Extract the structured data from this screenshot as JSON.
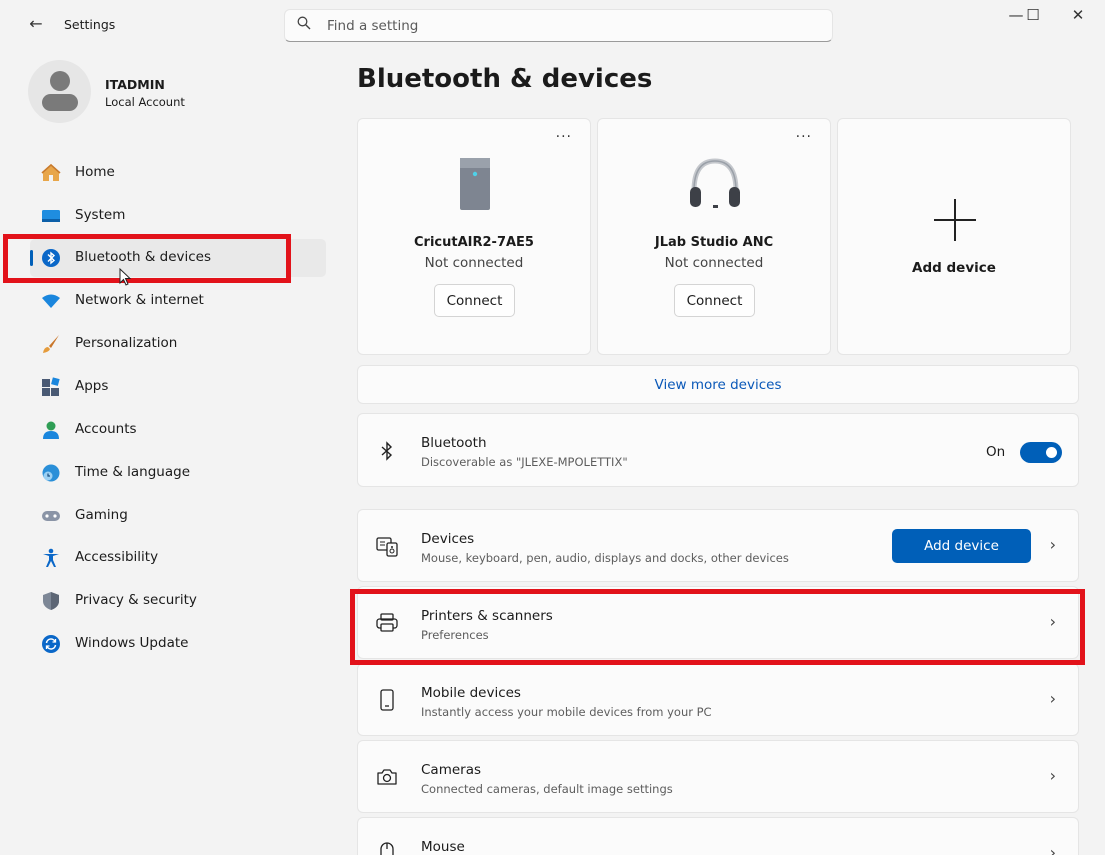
{
  "titlebar": {
    "back_glyph": "←",
    "app_title": "Settings",
    "search_placeholder": "Find a setting",
    "minimize_glyph": "—",
    "maximize_glyph": "☐",
    "close_glyph": "✕"
  },
  "profile": {
    "name": "ITADMIN",
    "account_type": "Local Account"
  },
  "sidebar": {
    "items": [
      {
        "label": "Home",
        "icon": "home-icon"
      },
      {
        "label": "System",
        "icon": "system-icon"
      },
      {
        "label": "Bluetooth & devices",
        "icon": "bluetooth-icon",
        "selected": true
      },
      {
        "label": "Network & internet",
        "icon": "wifi-icon"
      },
      {
        "label": "Personalization",
        "icon": "brush-icon"
      },
      {
        "label": "Apps",
        "icon": "apps-icon"
      },
      {
        "label": "Accounts",
        "icon": "accounts-icon"
      },
      {
        "label": "Time & language",
        "icon": "globe-clock-icon"
      },
      {
        "label": "Gaming",
        "icon": "gamepad-icon"
      },
      {
        "label": "Accessibility",
        "icon": "accessibility-icon"
      },
      {
        "label": "Privacy & security",
        "icon": "shield-icon"
      },
      {
        "label": "Windows Update",
        "icon": "update-icon"
      }
    ]
  },
  "main": {
    "title": "Bluetooth & devices",
    "device_cards": [
      {
        "name": "CricutAIR2-7AE5",
        "status": "Not connected",
        "button": "Connect",
        "more": "···",
        "icon": "tower-icon"
      },
      {
        "name": "JLab Studio ANC",
        "status": "Not connected",
        "button": "Connect",
        "more": "···",
        "icon": "headset-icon"
      }
    ],
    "add_card": {
      "label": "Add device",
      "icon": "plus-icon"
    },
    "view_more": "View more devices",
    "bluetooth": {
      "title": "Bluetooth",
      "subtitle": "Discoverable as \"JLEXE-MPOLETTIX\"",
      "state": "On",
      "on": true
    },
    "rows": [
      {
        "title": "Devices",
        "subtitle": "Mouse, keyboard, pen, audio, displays and docks, other devices",
        "button": "Add device",
        "icon": "keyboard-icon"
      },
      {
        "title": "Printers & scanners",
        "subtitle": "Preferences",
        "icon": "printer-icon"
      },
      {
        "title": "Mobile devices",
        "subtitle": "Instantly access your mobile devices from your PC",
        "icon": "phone-icon"
      },
      {
        "title": "Cameras",
        "subtitle": "Connected cameras, default image settings",
        "icon": "camera-icon"
      },
      {
        "title": "Mouse",
        "icon": "mouse-icon"
      }
    ],
    "chevron": "›"
  },
  "colors": {
    "accent": "#005fb8",
    "highlight": "#e2121a",
    "link": "#0a58b8"
  }
}
